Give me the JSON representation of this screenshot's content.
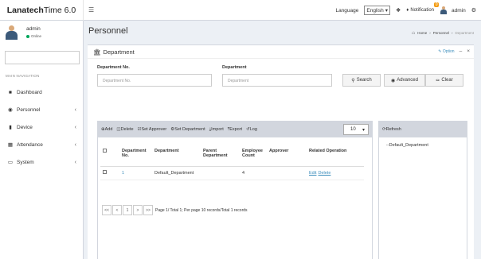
{
  "app": {
    "brand_bold": "Lanatech",
    "brand_rest": "Time 6.0"
  },
  "topbar": {
    "language_label": "Language",
    "language_value": "English",
    "notification_label": "Notification",
    "notification_badge": "0",
    "user_name": "admin"
  },
  "sidebar": {
    "user_name": "admin",
    "user_status": "Online",
    "nav_header": "MAIN NAVIGATION",
    "items": [
      {
        "label": "Dashboard"
      },
      {
        "label": "Personnel"
      },
      {
        "label": "Device"
      },
      {
        "label": "Attendance"
      },
      {
        "label": "System"
      }
    ]
  },
  "page": {
    "title": "Personnel",
    "breadcrumb": [
      "Home",
      "Personnel",
      "Department"
    ]
  },
  "box": {
    "title": "Department",
    "option_label": "Option"
  },
  "filters": {
    "dept_no_label": "Department No.",
    "dept_no_placeholder": "Department No.",
    "dept_label": "Department",
    "dept_placeholder": "Department",
    "search_label": "Search",
    "advanced_label": "Advanced",
    "clear_label": "Clear"
  },
  "toolbar": {
    "add": "Add",
    "delete": "Delete",
    "set_approver": "Set Approver",
    "set_department": "Set Department",
    "import": "Import",
    "export": "Export",
    "log": "Log",
    "page_size": "10"
  },
  "table": {
    "headers": [
      "Department No.",
      "Department",
      "Parent Department",
      "Employee Count",
      "Approver",
      "Related Operation"
    ],
    "rows": [
      {
        "no": "1",
        "department": "Default_Department",
        "parent": "",
        "count": "4",
        "approver": "",
        "edit": "Edit",
        "delete": "Delete"
      }
    ]
  },
  "pager": {
    "first": "<<",
    "prev": "<",
    "current": "1",
    "next": ">",
    "last": ">>",
    "info": "Page 1/ Total 1; Per page 10 records/Total 1 records"
  },
  "tree": {
    "refresh_label": "Refresh",
    "item": "--Default_Department"
  }
}
